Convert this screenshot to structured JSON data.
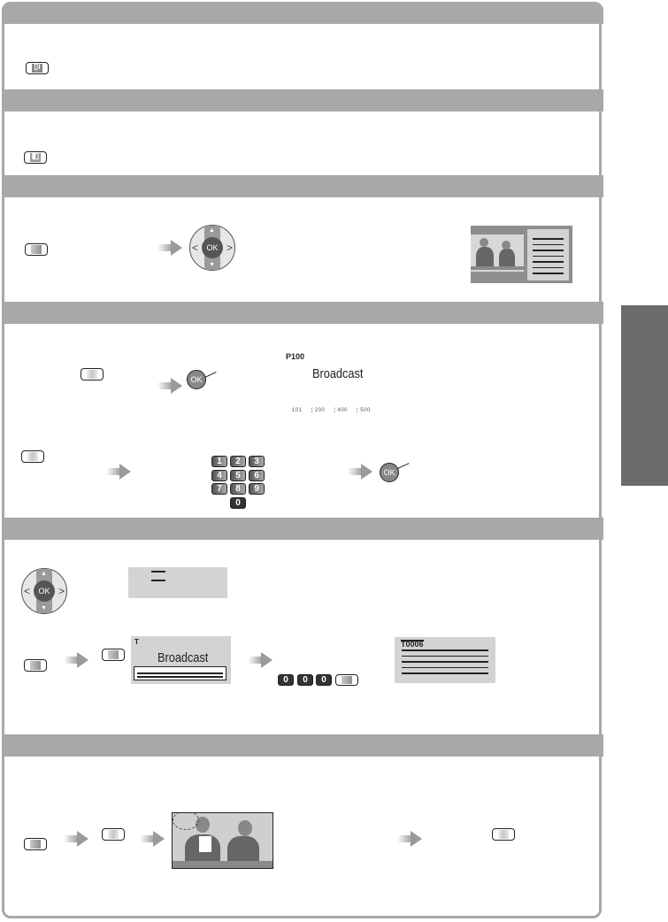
{
  "sections": [
    {
      "id": "section-1",
      "header": ""
    },
    {
      "id": "section-2",
      "header": ""
    },
    {
      "id": "section-3",
      "header": ""
    },
    {
      "id": "section-4",
      "header": ""
    },
    {
      "id": "section-5",
      "header": ""
    },
    {
      "id": "section-6",
      "header": ""
    }
  ],
  "icons": {
    "info_button": "info-button-icon",
    "hold_button": "hold-button-icon",
    "ok_label": "OK"
  },
  "section4": {
    "page_number": "P100",
    "page_title": "Broadcast",
    "fastext_pages": [
      "101",
      "200",
      "400",
      "500"
    ],
    "number_keys": [
      "1",
      "2",
      "3",
      "4",
      "5",
      "6",
      "7",
      "8",
      "9",
      "0"
    ]
  },
  "section5": {
    "page_title": "Broadcast",
    "page_prefix": "T",
    "subpage_keys": [
      "0",
      "0",
      "0"
    ],
    "subpage_code": "T0006"
  },
  "colors": {
    "header_bar": "#a7a8aa",
    "side_tab": "#6b6b6b",
    "panel": "#d3d3d3"
  }
}
